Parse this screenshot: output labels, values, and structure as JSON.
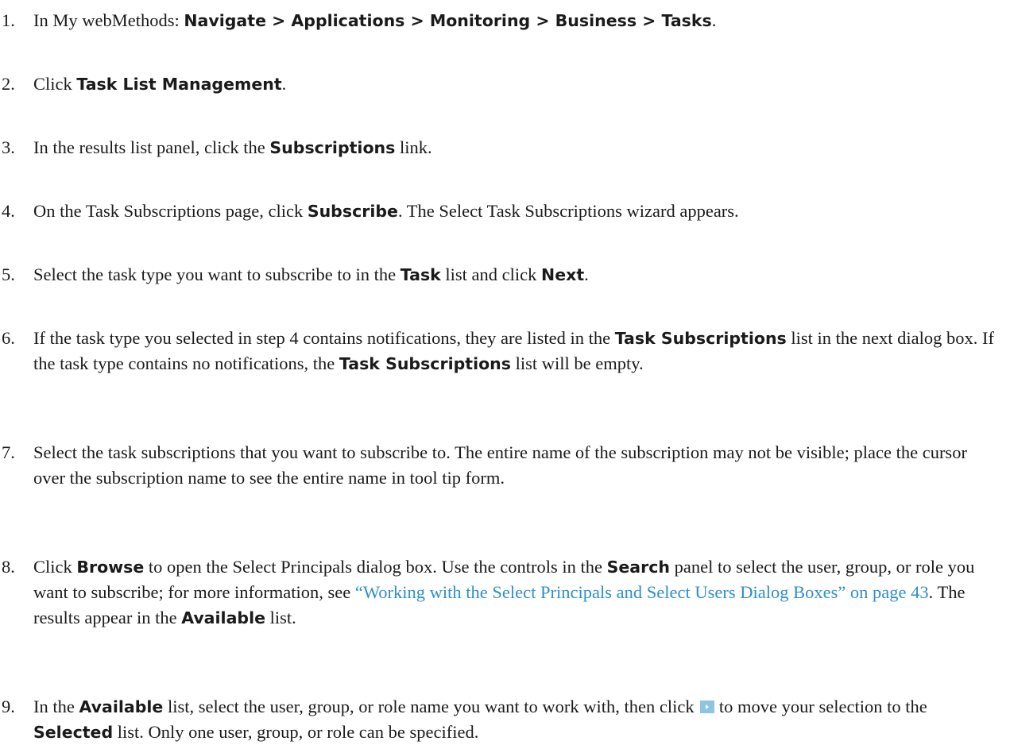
{
  "steps": [
    {
      "num": "1.",
      "parts": [
        {
          "t": "In My webMethods: "
        },
        {
          "b": "Navigate > Applications > Monitoring > Business > Tasks"
        },
        {
          "t": "."
        }
      ]
    },
    {
      "num": "2.",
      "parts": [
        {
          "t": "Click "
        },
        {
          "b": "Task List Management"
        },
        {
          "t": "."
        }
      ]
    },
    {
      "num": "3.",
      "parts": [
        {
          "t": "In the results list panel, click the "
        },
        {
          "b": "Subscriptions"
        },
        {
          "t": " link."
        }
      ]
    },
    {
      "num": "4.",
      "parts": [
        {
          "t": "On the Task Subscriptions page, click "
        },
        {
          "b": "Subscribe"
        },
        {
          "t": ". The Select Task Subscriptions wizard appears."
        }
      ]
    },
    {
      "num": "5.",
      "parts": [
        {
          "t": "Select the task type you want to subscribe to in the "
        },
        {
          "b": "Task"
        },
        {
          "t": " list and click "
        },
        {
          "b": "Next"
        },
        {
          "t": "."
        }
      ]
    },
    {
      "num": "6.",
      "parts": [
        {
          "t": "If the task type you selected in step 4 contains notifications, they are listed in the "
        },
        {
          "b": "Task Subscriptions"
        },
        {
          "t": " list in the next dialog box. If the task type contains no notifications, the "
        },
        {
          "b": "Task Subscriptions"
        },
        {
          "t": " list will be empty."
        }
      ]
    },
    {
      "num": "7.",
      "parts": [
        {
          "t": "Select the task subscriptions that you want to subscribe to. The entire name of the subscription may not be visible; place the cursor over the subscription name to see the entire name in tool tip form."
        }
      ]
    },
    {
      "num": "8.",
      "parts": [
        {
          "t": "Click "
        },
        {
          "b": "Browse"
        },
        {
          "t": " to open the Select Principals dialog box. Use the controls in the "
        },
        {
          "b": "Search"
        },
        {
          "t": " panel to select the user, group, or role you want to subscribe; for more information, see "
        },
        {
          "l": "“Working with the Select Principals and Select Users Dialog Boxes” on page 43"
        },
        {
          "t": ". The results appear in the "
        },
        {
          "b": "Available"
        },
        {
          "t": " list."
        }
      ]
    },
    {
      "num": "9.",
      "parts": [
        {
          "t": "In the "
        },
        {
          "b": "Available"
        },
        {
          "t": " list, select the user, group, or role name you want to work with, then click "
        },
        {
          "icon": "move-right-arrow-icon"
        },
        {
          "t": " to move your selection to the "
        },
        {
          "b": "Selected"
        },
        {
          "t": " list. Only one user, group, or role can be specified."
        }
      ]
    }
  ],
  "colors": {
    "text": "#1a1a1a",
    "link": "#2f8fc8",
    "arrow_button": "#8ec3e2"
  }
}
